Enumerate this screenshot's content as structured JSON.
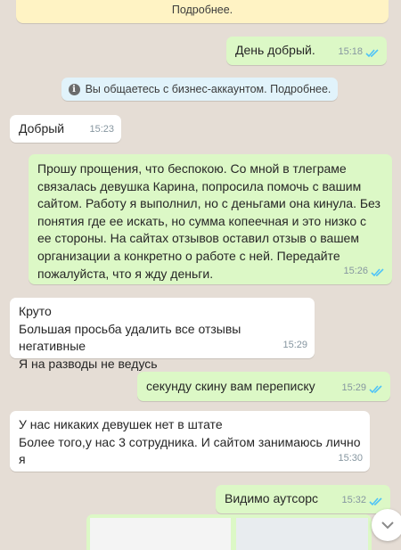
{
  "banner": {
    "text": "Подробнее."
  },
  "system_notice": {
    "icon": "info-icon",
    "text": "Вы общаетесь с бизнес-аккаунтом. Подробнее."
  },
  "messages": [
    {
      "dir": "out",
      "text": "День добрый.",
      "time": "15:18",
      "read": true
    },
    {
      "dir": "in",
      "text": "Добрый",
      "time": "15:23"
    },
    {
      "dir": "out",
      "text": "Прошу прощения, что беспокою. Со мной в тлеграме\nсвязалась девушка Карина, попросила помочь с вашим\nсайтом. Работу я выполнил, но с деньгами она кинула. Без\nпонятия где ее искать, но сумма копеечная и это низко с\nее стороны. На сайтах отзывов оставил отзыв о вашем\nорганизации а конкретно о работе с ней. Передайте\nпожалуйста, что я жду деньги.",
      "time": "15:26",
      "read": true
    },
    {
      "dir": "in",
      "text": "Круто\nБольшая просьба удалить все отзывы негативные\nЯ на разводы не ведусь",
      "time": "15:29"
    },
    {
      "dir": "out",
      "text": "секунду скину вам переписку",
      "time": "15:29",
      "read": true
    },
    {
      "dir": "in",
      "text": "У нас никаких девушек нет в штате\nБолее того,у нас 3 сотрудника. И сайтом занимаюсь лично\nя",
      "time": "15:30"
    },
    {
      "dir": "out",
      "text": "Видимо аутсорс",
      "time": "15:32",
      "read": true
    }
  ],
  "colors": {
    "outgoing": "#dcf8c6",
    "incoming": "#ffffff",
    "background": "#e5ddd5",
    "read_ticks": "#4fc3f7"
  },
  "scroll_button": {
    "icon": "chevron-down-icon"
  }
}
